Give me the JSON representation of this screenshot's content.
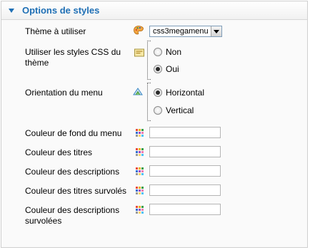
{
  "panel": {
    "title": "Options de styles"
  },
  "theme": {
    "label": "Thème à utiliser",
    "icon": "theme-palette-icon",
    "selected": "css3megamenu"
  },
  "use_css": {
    "label": "Utiliser les styles CSS du thème",
    "icon": "css-icon",
    "options": [
      {
        "label": "Non",
        "checked": false
      },
      {
        "label": "Oui",
        "checked": true
      }
    ]
  },
  "orientation": {
    "label": "Orientation du menu",
    "icon": "orientation-icon",
    "options": [
      {
        "label": "Horizontal",
        "checked": true
      },
      {
        "label": "Vertical",
        "checked": false
      }
    ]
  },
  "colors": [
    {
      "label": "Couleur de fond du menu",
      "value": ""
    },
    {
      "label": "Couleur des titres",
      "value": ""
    },
    {
      "label": "Couleur des descriptions",
      "value": ""
    },
    {
      "label": "Couleur des titres survolés",
      "value": ""
    },
    {
      "label": "Couleur des descriptions survolées",
      "value": ""
    }
  ],
  "colors_icon": "color-palette-icon",
  "palette_colors": [
    "#e94b3c",
    "#f0b400",
    "#3aa04a",
    "#2e6fd0",
    "#9b4fc9",
    "#f07bb0",
    "#999999",
    "#ffd966",
    "#4fc3f7"
  ]
}
